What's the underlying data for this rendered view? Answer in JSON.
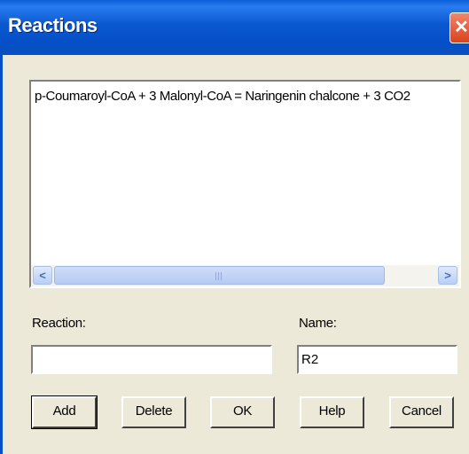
{
  "window": {
    "title": "Reactions"
  },
  "reactions_list": {
    "items": [
      "p-Coumaroyl-CoA + 3 Malonyl-CoA = Naringenin chalcone + 3 CO2"
    ]
  },
  "form": {
    "reaction_label": "Reaction:",
    "reaction_value": "",
    "name_label": "Name:",
    "name_value": "R2"
  },
  "buttons": {
    "add": "Add",
    "delete": "Delete",
    "ok": "OK",
    "help": "Help",
    "cancel": "Cancel"
  },
  "icons": {
    "close": "close-icon",
    "scroll_left": "scroll-left-icon",
    "scroll_right": "scroll-right-icon"
  },
  "colors": {
    "titlebar": "#0550c8",
    "dialog_bg": "#ece9d8",
    "close_button": "#d9431c"
  }
}
